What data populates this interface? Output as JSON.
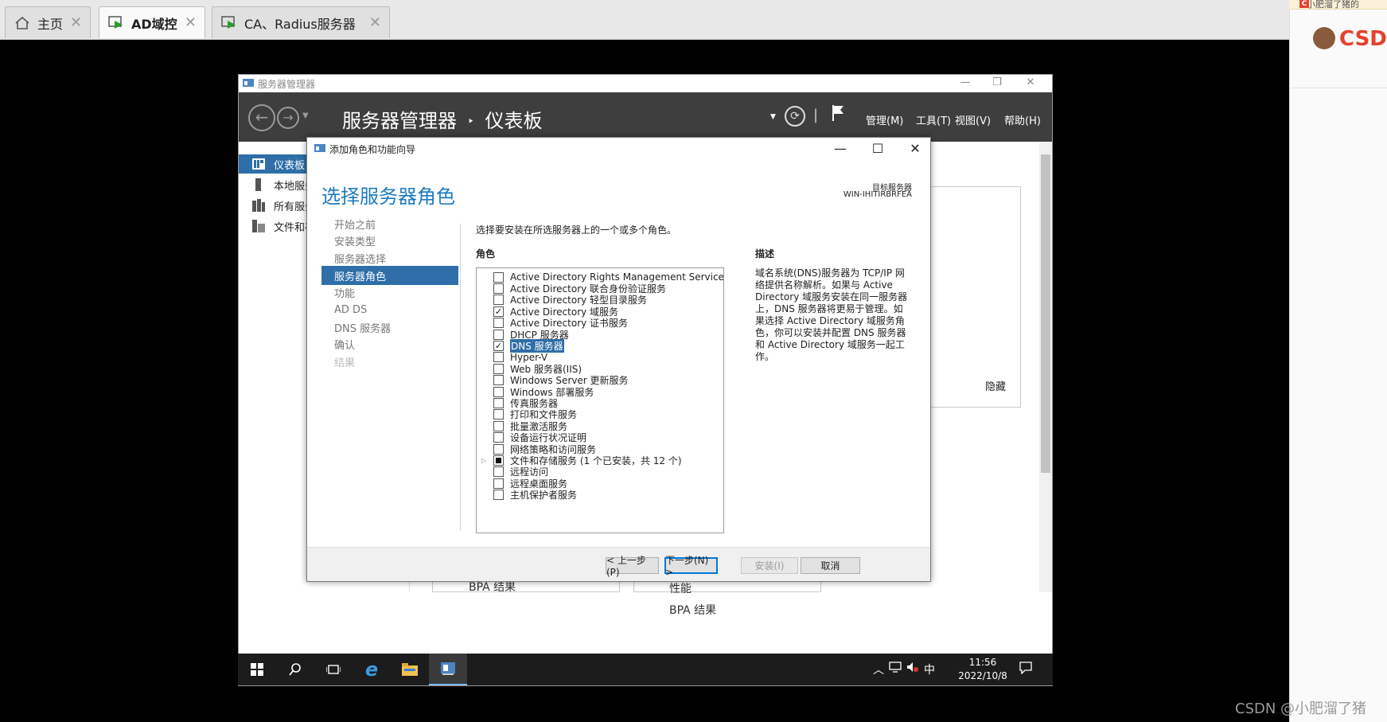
{
  "host_tabs": [
    {
      "label": "主页",
      "icon": "home-icon",
      "active": false
    },
    {
      "label": "AD域控",
      "icon": "vm-icon",
      "active": true
    },
    {
      "label": "CA、Radius服务器",
      "icon": "vm-icon",
      "active": false
    }
  ],
  "csdn": {
    "logo_text": "CSDr",
    "top_text": "小肥溜了猪的",
    "watermark": "CSDN @小肥溜了猪"
  },
  "server_manager": {
    "window_title": "服务器管理器",
    "breadcrumb_app": "服务器管理器",
    "breadcrumb_sep": "‣",
    "breadcrumb_page": "仪表板",
    "menus": {
      "manage": "管理(M)",
      "tools": "工具(T)",
      "view": "视图(V)",
      "help": "帮助(H)"
    },
    "nav": [
      {
        "label": "仪表板",
        "icon": "dashboard-icon"
      },
      {
        "label": "本地服务",
        "icon": "server-icon"
      },
      {
        "label": "所有服务",
        "icon": "servers-icon"
      },
      {
        "label": "文件和存",
        "icon": "file-storage-icon"
      }
    ],
    "hide_label": "隐藏",
    "tiles": {
      "bpa_left": "BPA 结果",
      "perf_right": "性能",
      "bpa_right": "BPA 结果"
    }
  },
  "taskbar": {
    "time": "11:56",
    "date": "2022/10/8",
    "ime": "中"
  },
  "wizard": {
    "title": "添加角色和功能向导",
    "heading": "选择服务器角色",
    "target_label": "目标服务器",
    "target_value": "WIN-IHITIRBRFEA",
    "steps": [
      {
        "label": "开始之前",
        "state": "normal"
      },
      {
        "label": "安装类型",
        "state": "normal"
      },
      {
        "label": "服务器选择",
        "state": "normal"
      },
      {
        "label": "服务器角色",
        "state": "active"
      },
      {
        "label": "功能",
        "state": "normal"
      },
      {
        "label": "AD DS",
        "state": "normal"
      },
      {
        "label": "DNS 服务器",
        "state": "normal"
      },
      {
        "label": "确认",
        "state": "normal"
      },
      {
        "label": "结果",
        "state": "disabled"
      }
    ],
    "intro": "选择要安装在所选服务器上的一个或多个角色。",
    "roles_label": "角色",
    "description_label": "描述",
    "description_text": "域名系统(DNS)服务器为 TCP/IP 网络提供名称解析。如果与 Active Directory 域服务安装在同一服务器上，DNS 服务器将更易于管理。如果选择 Active Directory 域服务角色，你可以安装并配置 DNS 服务器和 Active Directory 域服务一起工作。",
    "roles": [
      {
        "label": "Active Directory Rights Management Services",
        "checked": false
      },
      {
        "label": "Active Directory 联合身份验证服务",
        "checked": false
      },
      {
        "label": "Active Directory 轻型目录服务",
        "checked": false
      },
      {
        "label": "Active Directory 域服务",
        "checked": true
      },
      {
        "label": "Active Directory 证书服务",
        "checked": false
      },
      {
        "label": "DHCP 服务器",
        "checked": false
      },
      {
        "label": "DNS 服务器",
        "checked": true,
        "selected": true
      },
      {
        "label": "Hyper-V",
        "checked": false
      },
      {
        "label": "Web 服务器(IIS)",
        "checked": false
      },
      {
        "label": "Windows Server 更新服务",
        "checked": false
      },
      {
        "label": "Windows 部署服务",
        "checked": false
      },
      {
        "label": "传真服务器",
        "checked": false
      },
      {
        "label": "打印和文件服务",
        "checked": false
      },
      {
        "label": "批量激活服务",
        "checked": false
      },
      {
        "label": "设备运行状况证明",
        "checked": false
      },
      {
        "label": "网络策略和访问服务",
        "checked": false
      },
      {
        "label": "文件和存储服务 (1 个已安装，共 12 个)",
        "checked": "partial",
        "expandable": true
      },
      {
        "label": "远程访问",
        "checked": false
      },
      {
        "label": "远程桌面服务",
        "checked": false
      },
      {
        "label": "主机保护者服务",
        "checked": false
      }
    ],
    "buttons": {
      "prev": "< 上一步(P)",
      "next": "下一步(N) >",
      "install": "安装(I)",
      "cancel": "取消"
    }
  }
}
